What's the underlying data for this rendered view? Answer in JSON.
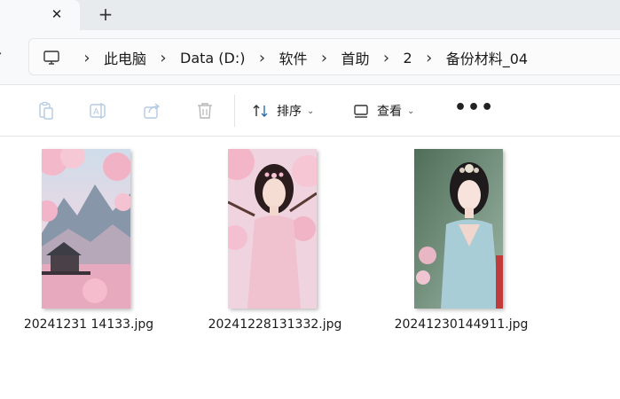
{
  "tabs": {
    "close_glyph": "✕",
    "new_tab_glyph": "+"
  },
  "address": {
    "root_icon": "computer-icon",
    "separator": "›",
    "crumbs": [
      "此电脑",
      "Data (D:)",
      "软件",
      "首助",
      "2",
      "备份材料_04"
    ]
  },
  "toolbar": {
    "copy_icon": "copy-icon",
    "rename_icon": "rename-icon",
    "share_icon": "share-icon",
    "delete_icon": "trash-icon",
    "sort_label": "排序",
    "view_label": "查看",
    "more_label": "•••"
  },
  "files": [
    {
      "name": "20241231 14133.jpg"
    },
    {
      "name": "20241228131332.jpg"
    },
    {
      "name": "20241230144911.jpg"
    }
  ],
  "colors": {
    "accent": "#0067c0",
    "tab_bg": "#e8ebee",
    "window_bg": "#f7f9fb"
  }
}
